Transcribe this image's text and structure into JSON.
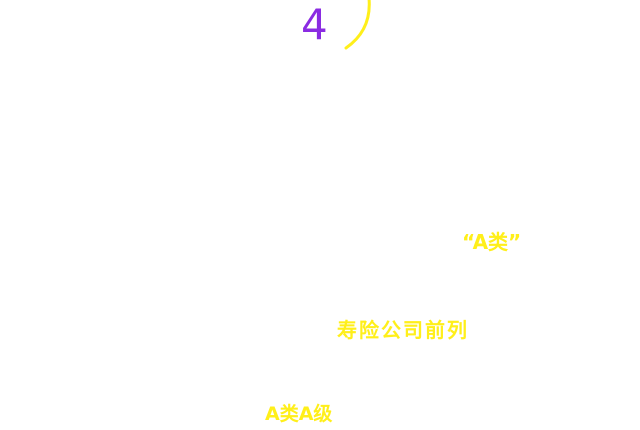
{
  "step": {
    "number": "4"
  },
  "highlights": {
    "rating_quoted": "“A类”",
    "ranking": "寿险公司前列",
    "rating_level": "A类A级"
  },
  "colors": {
    "number": "#8a2be2",
    "highlight": "#ffef1a",
    "background": "#ffffff"
  }
}
